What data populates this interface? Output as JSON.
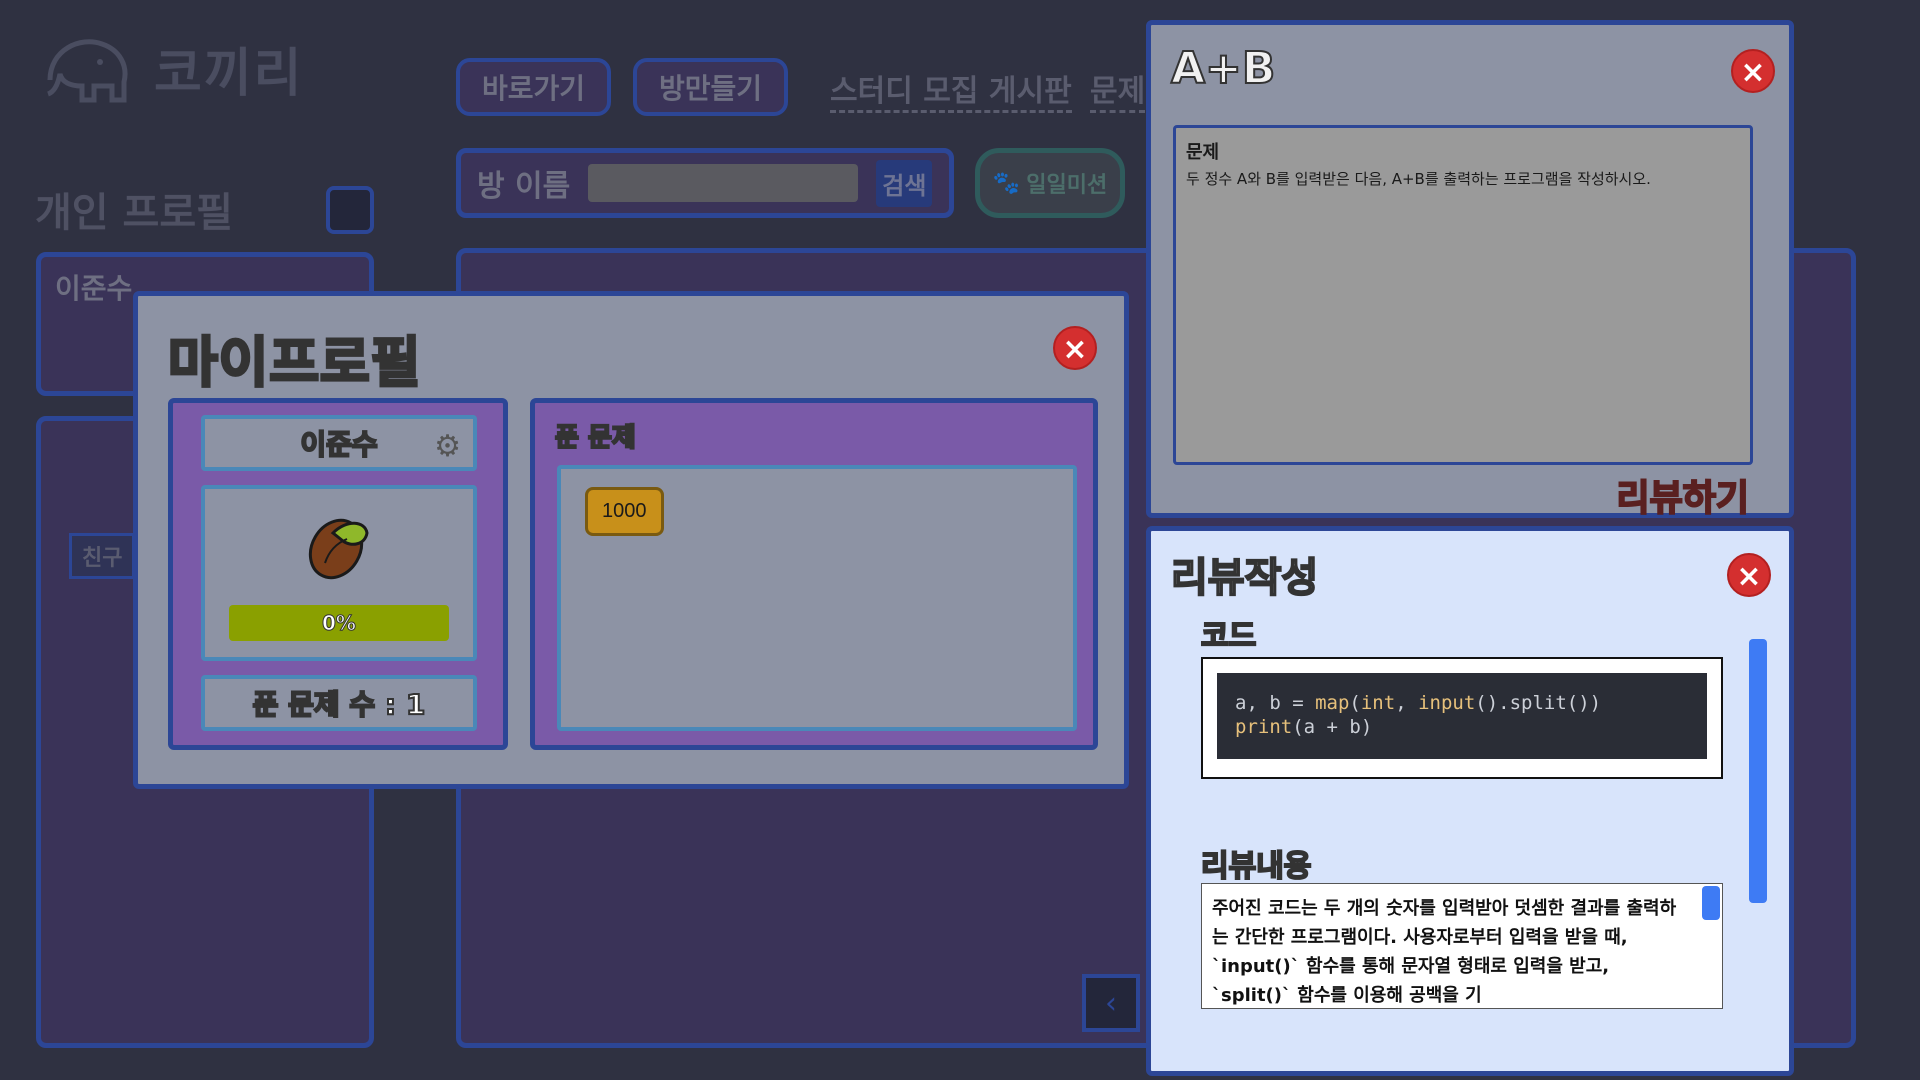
{
  "app": {
    "logo_text": "코끼리",
    "nav": [
      "바로가기",
      "방만들기"
    ],
    "nav_link": "스터디 모집 게시판",
    "nav_link2": "문제",
    "search": {
      "label": "방 이름",
      "button": "검색",
      "value": ""
    },
    "mission_button": "일일미션",
    "profile_heading": "개인 프로필",
    "profile_name": "이준수",
    "friend_label": "친구"
  },
  "my_profile": {
    "title": "마이프로필",
    "name": "이준수",
    "progress_text": "0%",
    "progress_fraction": 0,
    "solved_count_text": "푼 문제 수 : 1",
    "solved_title": "푼 문제",
    "solved_problems": [
      "1000"
    ],
    "colors": {
      "panel": "#7a5aa8",
      "progress": "#8aa000",
      "chip": "#c8901a"
    }
  },
  "problem": {
    "title": "A+B",
    "label": "문제",
    "text": "두 정수 A와 B를 입력받은 다음, A+B를 출력하는 프로그램을 작성하시오.",
    "review_button": "리뷰하기"
  },
  "review": {
    "title": "리뷰작성",
    "code_label": "코드",
    "code_line1_a": "a, b = ",
    "code_line1_fn1": "map",
    "code_line1_b": "(",
    "code_line1_fn2": "int",
    "code_line1_c": ", ",
    "code_line1_fn3": "input",
    "code_line1_d": "().split())",
    "code_line2_fn": "print",
    "code_line2_rest": "(a + b)",
    "content_label": "리뷰내용",
    "content_text": "주어진 코드는 두 개의 숫자를 입력받아 덧셈한 결과를 출력하는 간단한 프로그램이다. 사용자로부터 입력을 받을 때, `input()` 함수를 통해 문자열 형태로 입력을 받고, `split()` 함수를 이용해 공백을 기"
  }
}
